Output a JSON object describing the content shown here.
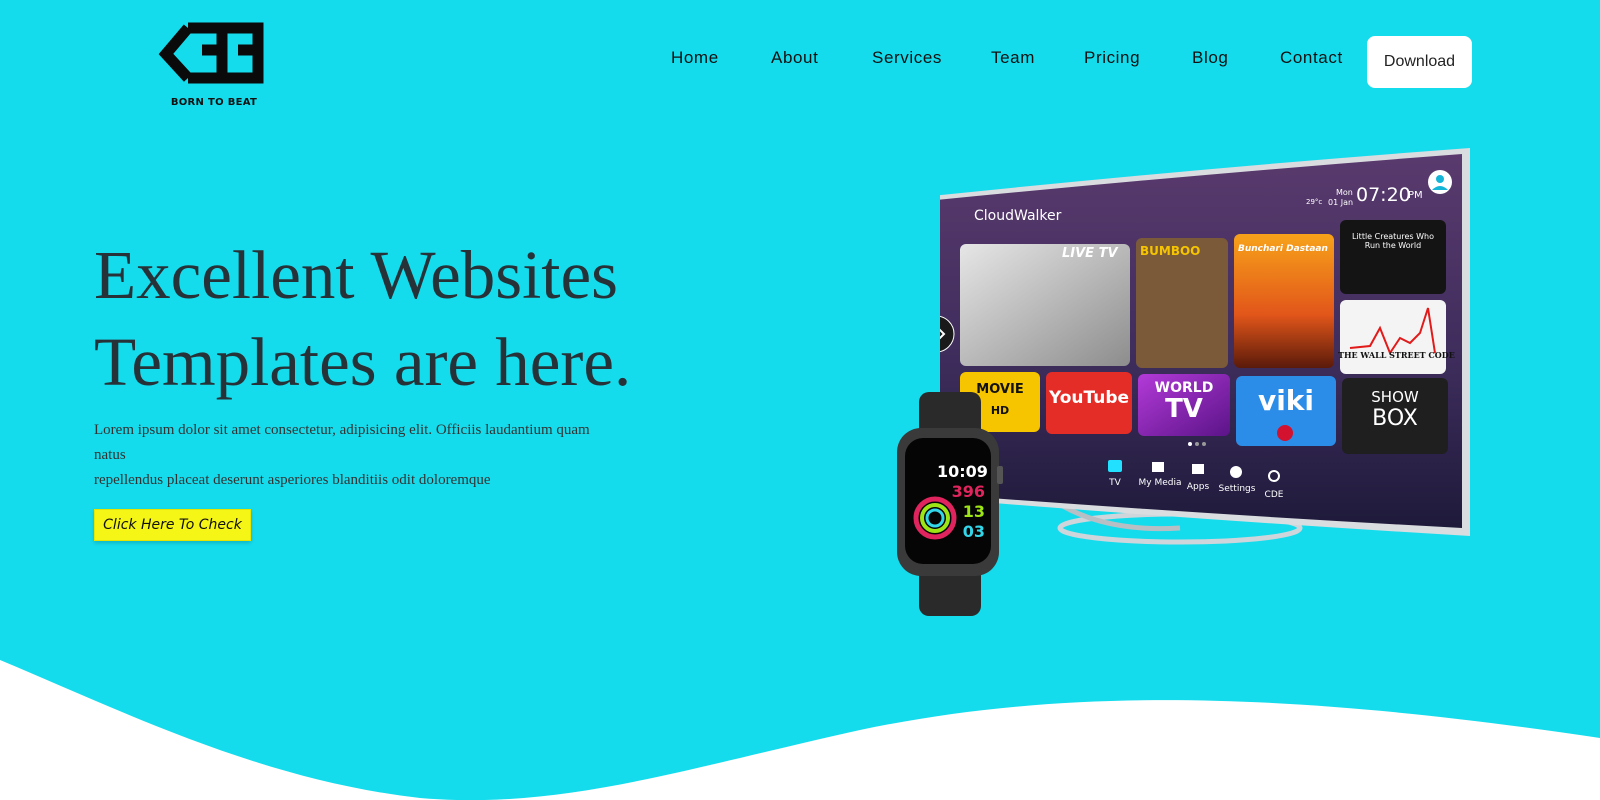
{
  "brand": {
    "logo_text": "BORN TO BEAT"
  },
  "nav": {
    "items": [
      {
        "label": "Home"
      },
      {
        "label": "About"
      },
      {
        "label": "Services"
      },
      {
        "label": "Team"
      },
      {
        "label": "Pricing"
      },
      {
        "label": "Blog"
      },
      {
        "label": "Contact"
      }
    ],
    "download_label": "Download"
  },
  "hero": {
    "title_line1": "Excellent Websites",
    "title_line2": "Templates are here.",
    "desc_line1": "Lorem ipsum dolor sit amet consectetur, adipisicing elit. Officiis laudantium quam",
    "desc_line2": "natus",
    "desc_line3": "repellendus placeat deserunt asperiores blanditiis odit doloremque",
    "cta_label": "Click Here To Check"
  },
  "tv": {
    "brand": "CloudWalker",
    "weather": "29°c",
    "day": "Mon",
    "date": "01 Jan",
    "time": "07:20",
    "ampm": "PM",
    "tiles": {
      "live": "LIVE TV",
      "bumboo": "BUMBOO",
      "sunset": "Bunchari Dastaan",
      "creatures": "Little Creatures Who Run the World",
      "wsj": "THE WALL STREET CODE",
      "movie": "MOVIE",
      "movie_hd": "HD",
      "youtube": "YouTube",
      "world": "WORLD",
      "world_tv": "TV",
      "viki": "viki",
      "show": "SHOW",
      "box": "BOX"
    },
    "menu": [
      {
        "label": "TV"
      },
      {
        "label": "My Media"
      },
      {
        "label": "Apps"
      },
      {
        "label": "Settings"
      },
      {
        "label": "CDE"
      }
    ]
  },
  "watch": {
    "time": "10:09",
    "move": "396",
    "exercise": "13",
    "stand": "03"
  },
  "colors": {
    "background": "#15dcec",
    "cta": "#f5f516",
    "download_bg": "#ffffff",
    "title_text": "#263238"
  }
}
